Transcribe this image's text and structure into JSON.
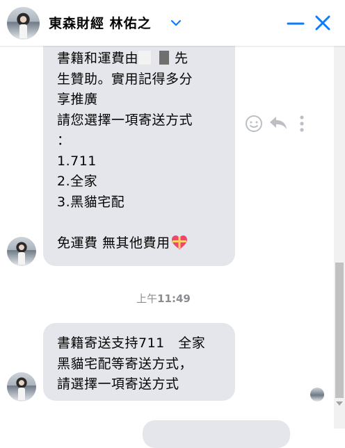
{
  "header": {
    "title": "東森財經 林佑之",
    "icons": {
      "chevron": "chevron-down-icon",
      "minimize": "minimize-icon",
      "close": "close-icon"
    },
    "accent_color": "#0a7cff"
  },
  "messages": {
    "first": {
      "line1_before": "書籍和運費由",
      "line1_after": "先",
      "line2": "生贊助。實用記得多分",
      "line3": "享推廣",
      "line4": "請您選擇一項寄送方式",
      "line5": "：",
      "line6": "1.711",
      "line7": "2.全家",
      "line8": "3.黑貓宅配",
      "line9": "免運費 無其他費用",
      "line9_emoji": "heart-gift-icon"
    },
    "timestamp": {
      "period": "上午",
      "time": "11:49"
    },
    "second": {
      "line1": "書籍寄送支持711　全家",
      "line2": "黑貓宅配等寄送方式，",
      "line3": "請選擇一項寄送方式"
    }
  },
  "colors": {
    "bubble_bg": "#e4e6eb",
    "timestamp": "#8a8d91",
    "action_icon": "#bcc0c4"
  }
}
